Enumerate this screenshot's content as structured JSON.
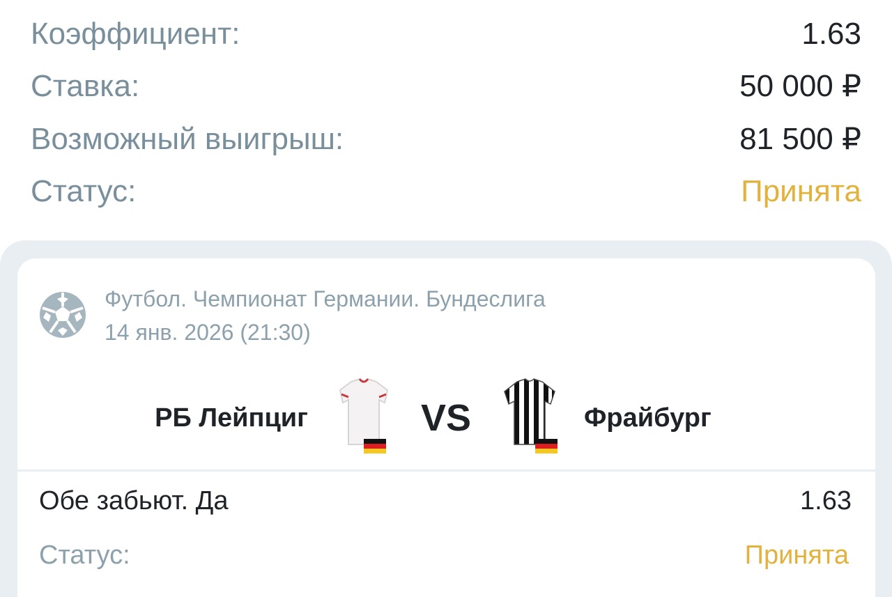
{
  "summary": {
    "rows": [
      {
        "label": "Коэффициент:",
        "value": "1.63"
      },
      {
        "label": "Ставка:",
        "value": "50 000 ₽"
      },
      {
        "label": "Возможный выигрыш:",
        "value": "81 500 ₽"
      },
      {
        "label": "Статус:",
        "value": "Принята"
      }
    ]
  },
  "event": {
    "league_icon": "soccer-ball-icon",
    "league": "Футбол. Чемпионат Германии. Бундеслига",
    "date": "14 янв. 2026 (21:30)",
    "home_team": "РБ Лейпциг",
    "away_team": "Фрайбург",
    "vs": "VS",
    "home_jersey_icon": "white-jersey-icon",
    "away_jersey_icon": "striped-jersey-icon",
    "flag_icon": "germany-flag-icon"
  },
  "bet": {
    "market": "Обе забьют. Да",
    "odds": "1.63",
    "status_label": "Статус:",
    "status_value": "Принята"
  },
  "colors": {
    "label": "#7a8f9c",
    "text": "#1f2327",
    "accepted": "#e3b23c",
    "panel": "#e9eef2"
  }
}
